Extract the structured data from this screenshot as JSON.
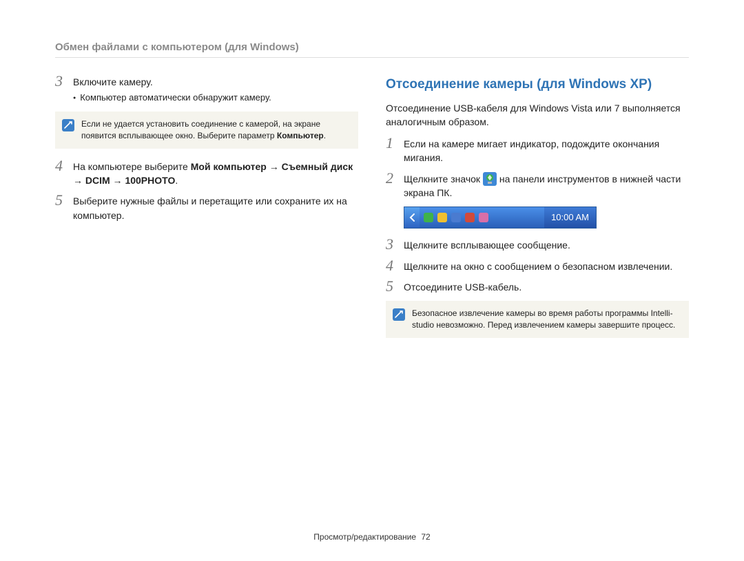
{
  "header": {
    "title": "Обмен файлами с компьютером (для Windows)"
  },
  "left": {
    "steps": [
      {
        "num": "3",
        "text": "Включите камеру.",
        "bullet": "Компьютер автоматически обнаружит камеру."
      },
      {
        "num": "4",
        "text_pre": "На компьютере выберите ",
        "bold1": "Мой компьютер",
        "arrow1": " → ",
        "bold2": "Съемный диск",
        "arrow2": " → ",
        "bold3": "DCIM",
        "arrow3": " → ",
        "bold4": "100PHOTO",
        "text_post": "."
      },
      {
        "num": "5",
        "text": "Выберите нужные файлы и перетащите или сохраните их на компьютер."
      }
    ],
    "note": {
      "text_pre": "Если не удается установить соединение с камерой, на экране появится всплывающее окно. Выберите параметр ",
      "bold": "Компьютер",
      "text_post": "."
    }
  },
  "right": {
    "heading": "Отсоединение камеры (для Windows XP)",
    "intro": "Отсоединение USB-кабеля для Windows Vista или 7 выполняется аналогичным образом.",
    "steps": [
      {
        "num": "1",
        "text": "Если на камере мигает индикатор, подождите окончания мигания."
      },
      {
        "num": "2",
        "text_pre": "Щелкните значок ",
        "text_post": " на панели инструментов в нижней части экрана ПК."
      },
      {
        "num": "3",
        "text": "Щелкните всплывающее сообщение."
      },
      {
        "num": "4",
        "text": "Щелкните на окно с сообщением о безопасном извлечении."
      },
      {
        "num": "5",
        "text": "Отсоедините USB-кабель."
      }
    ],
    "tray": {
      "time": "10:00 AM"
    },
    "note": {
      "text": "Безопасное извлечение камеры во время работы программы Intelli-studio невозможно. Перед извлечением камеры завершите процесс."
    }
  },
  "footer": {
    "section": "Просмотр/редактирование",
    "page": "72"
  }
}
